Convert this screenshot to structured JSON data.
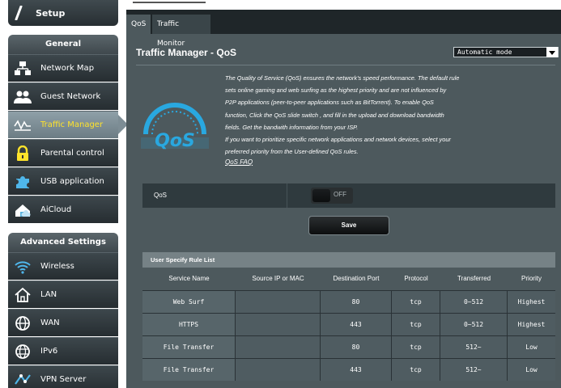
{
  "sidebar": {
    "setup_label": "Setup",
    "general_header": "General",
    "general_items": [
      {
        "label": "Network Map",
        "icon": "network-map-icon"
      },
      {
        "label": "Guest Network",
        "icon": "guest-network-icon"
      },
      {
        "label": "Traffic Manager",
        "icon": "traffic-manager-icon",
        "active": true
      },
      {
        "label": "Parental control",
        "icon": "lock-icon"
      },
      {
        "label": "USB application",
        "icon": "puzzle-icon"
      },
      {
        "label": "AiCloud",
        "icon": "cloud-house-icon"
      }
    ],
    "advanced_header": "Advanced Settings",
    "advanced_items": [
      {
        "label": "Wireless",
        "icon": "wifi-icon"
      },
      {
        "label": "LAN",
        "icon": "house-icon"
      },
      {
        "label": "WAN",
        "icon": "globe-icon"
      },
      {
        "label": "IPv6",
        "icon": "ipv6-globe-icon"
      },
      {
        "label": "VPN Server",
        "icon": "vpn-icon"
      }
    ]
  },
  "tabs": [
    {
      "label": "QoS",
      "active": true
    },
    {
      "label": "Traffic Monitor",
      "active": false
    }
  ],
  "page": {
    "title": "Traffic Manager - QoS",
    "mode_select_value": "Automatic mode",
    "description_lines": [
      "The Quality of Service (QoS) ensures the network's speed performance. The default rule",
      "sets online gaming and web surfing as the highest priority and are not influenced by",
      "P2P applications (peer-to-peer applications such as BitTorrent). To enable QoS",
      "function, Click the QoS slide switch , and fill in the upload and download bandwidth",
      "fields. Get the bandwith information from your ISP.",
      "If you want to prioritize specific network applications and network devices, select your",
      "preferred priority from the User-defined QoS rules."
    ],
    "faq_link": "QoS FAQ",
    "logo_text": "QoS",
    "qos_label": "QoS",
    "qos_toggle_state": "OFF",
    "save_label": "Save"
  },
  "rules": {
    "title": "User Specify Rule List",
    "columns": [
      "Service Name",
      "Source IP or MAC",
      "Destination Port",
      "Protocol",
      "Transferred",
      "Priority"
    ],
    "rows": [
      [
        "Web Surf",
        "",
        "80",
        "tcp",
        "0~512",
        "Highest"
      ],
      [
        "HTTPS",
        "",
        "443",
        "tcp",
        "0~512",
        "Highest"
      ],
      [
        "File Transfer",
        "",
        "80",
        "tcp",
        "512~",
        "Low"
      ],
      [
        "File Transfer",
        "",
        "443",
        "tcp",
        "512~",
        "Low"
      ]
    ]
  },
  "colors": {
    "active_label": "#ffe32b",
    "panel_bg": "#4d595d",
    "logo_blue": "#29a8e0"
  }
}
